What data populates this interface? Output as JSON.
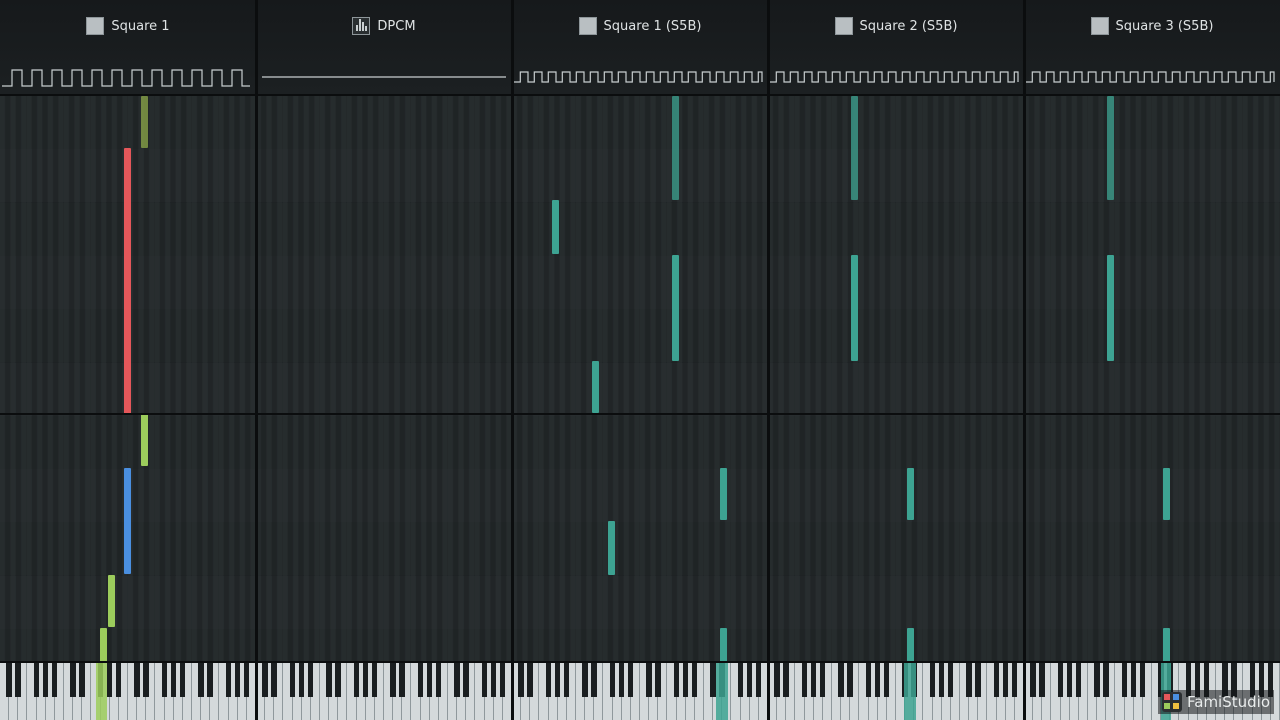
{
  "channels": [
    {
      "name": "Square 1",
      "icon": "square-wave-icon"
    },
    {
      "name": "DPCM",
      "icon": "dpcm-sample-icon"
    },
    {
      "name": "Square 1 (S5B)",
      "icon": "square-wave-icon"
    },
    {
      "name": "Square 2 (S5B)",
      "icon": "square-wave-icon"
    },
    {
      "name": "Square 3 (S5B)",
      "icon": "square-wave-icon"
    }
  ],
  "logo": {
    "text": "FamiStudio",
    "icon": "famistudio-logo-icon"
  },
  "colors": {
    "background": "#1f2426",
    "divider": "#0b0d0e",
    "teal_note": "#3da392",
    "red_note": "#e5575a",
    "blue_note": "#4a8fe0",
    "green_note": "#9ccc5c",
    "olive_note": "#8ea84a"
  }
}
